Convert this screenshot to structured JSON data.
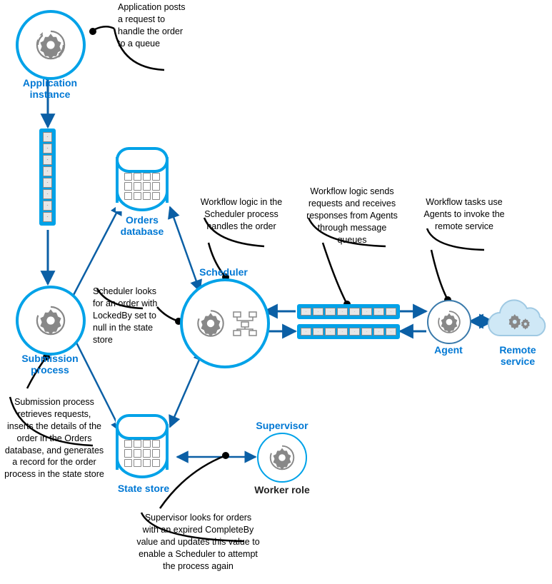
{
  "colors": {
    "accent": "#00a2e8",
    "accent_dark": "#0b5fa5",
    "gray_stroke": "#888888",
    "black": "#000000"
  },
  "nodes": {
    "app_instance": "Application\ninstance",
    "submission": "Submission\nprocess",
    "orders_db": "Orders\ndatabase",
    "scheduler": "Scheduler",
    "state_store": "State store",
    "supervisor": "Supervisor",
    "worker_role": "Worker role",
    "agent": "Agent",
    "remote_service": "Remote\nservice"
  },
  "callouts": {
    "app_instance": "Application posts a request to handle the order to a queue",
    "submission": "Submission process retrieves requests, inserts the details of the order in the Orders database, and generates a record for the order process in the state store",
    "scheduler_lookup": "Scheduler looks for an order with LockedBy set to null in the state store",
    "scheduler_logic": "Workflow logic in the Scheduler process handles the order",
    "scheduler_queue": "Workflow logic sends requests and receives responses from Agents through message queues",
    "agent": "Workflow tasks use Agents to invoke the remote service",
    "supervisor": "Supervisor looks for orders with an expired CompleteBy value and updates this value to enable a Scheduler to attempt the process again"
  },
  "icons": {
    "gear": "gear-icon",
    "grid": "grid-icon",
    "workflow": "workflow-icon",
    "envelope": "envelope-icon",
    "cloud": "cloud-icon"
  }
}
